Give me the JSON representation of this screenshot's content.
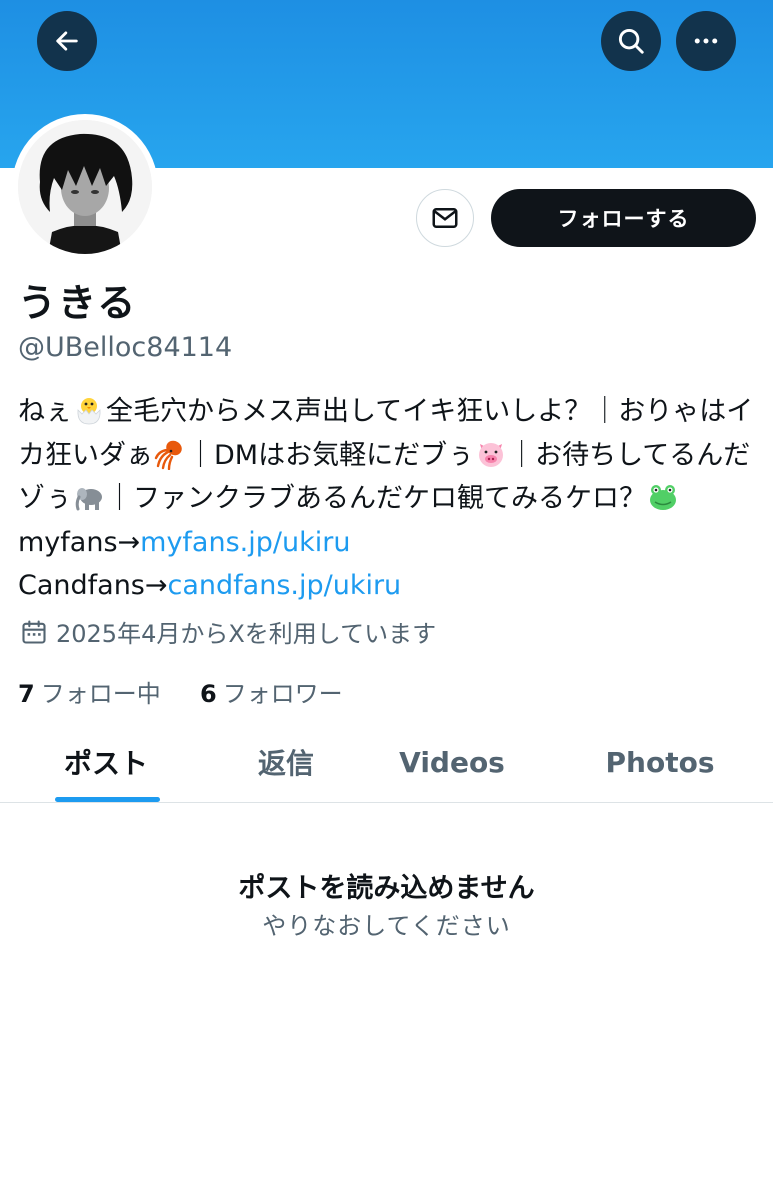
{
  "profile": {
    "name": "うきる",
    "handle": "@UBelloc84114",
    "follow_label": "フォローする",
    "bio": {
      "t1": "ねぇ",
      "t2": "全毛穴からメス声出してイキ狂いしよ？｜おりゃはイカ狂いダぁ",
      "t3": "｜DMはお気軽にだブぅ",
      "t4": "｜お待ちしてるんだゾぅ",
      "t5": "｜ファンクラブあるんだケロ観てみるケロ？",
      "t6": "myfans→",
      "link1": "myfans.jp/ukiru",
      "t7": "Candfans→",
      "link2": "candfans.jp/ukiru"
    },
    "joined": "2025年4月からXを利用しています",
    "following_count": "7",
    "following_label": "フォロー中",
    "followers_count": "6",
    "followers_label": "フォロワー"
  },
  "tabs": [
    {
      "label": "ポスト",
      "active": true
    },
    {
      "label": "返信",
      "active": false
    },
    {
      "label": "Videos",
      "active": false
    },
    {
      "label": "Photos",
      "active": false
    }
  ],
  "error": {
    "title": "ポストを読み込めません",
    "subtitle": "やりなおしてください"
  },
  "icons": {
    "back": "arrow-left-icon",
    "search": "search-icon",
    "more": "more-dots-icon",
    "message": "envelope-icon",
    "calendar": "calendar-icon"
  },
  "colors": {
    "banner": "#27a5ee",
    "accent": "#1d9bf0",
    "follow_button": "#0f1419",
    "secondary_text": "#536471"
  }
}
